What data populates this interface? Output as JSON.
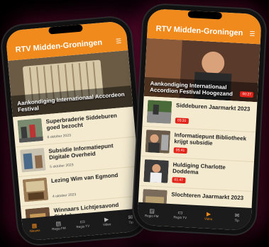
{
  "left_phone": {
    "app_title": "RTV Midden-Groningen",
    "menu_icon": "hamburger-icon",
    "hero_caption": "Aankondiging Internationaal Accordeon Festival",
    "items": [
      {
        "title": "Superbraderie Siddeburen goed bezocht",
        "date": "6 oktober 2023"
      },
      {
        "title": "Subsidie Informatiepunt Digitale Overheid",
        "date": "5 oktober 2023"
      },
      {
        "title": "Lezing Wim van Egmond",
        "date": "4 oktober 2023"
      },
      {
        "title": "Winnaars Lichtjesavond Siddeburen",
        "date": ""
      }
    ],
    "tabs": [
      {
        "label": "Nieuws",
        "icon": "newspaper-icon"
      },
      {
        "label": "Regio FM",
        "icon": "radio-icon"
      },
      {
        "label": "Regio TV",
        "icon": "tv-icon"
      },
      {
        "label": "Video",
        "icon": "video-icon"
      },
      {
        "label": "Tip",
        "icon": "chat-icon"
      }
    ],
    "active_tab": 0
  },
  "right_phone": {
    "app_title": "RTV Midden-Groningen",
    "menu_icon": "hamburger-icon",
    "hero_caption": "Aankondiging Internationaal Accordion Festival Hoogezand",
    "hero_badge": "00:27",
    "items": [
      {
        "title": "Siddeburen Jaarmarkt 2023",
        "badge": "03:31"
      },
      {
        "title": "Informatiepunt Bibliotheek krijgt subsidie",
        "badge": "05:41"
      },
      {
        "title": "Huldiging Charlotte Doddema",
        "badge": "01:47"
      },
      {
        "title": "Slochteren Jaarmarkt 2023",
        "badge": ""
      }
    ],
    "tabs": [
      {
        "label": "Regio FM",
        "icon": "radio-icon"
      },
      {
        "label": "Regio TV",
        "icon": "tv-icon"
      },
      {
        "label": "Video",
        "icon": "video-icon"
      },
      {
        "label": "Tip",
        "icon": "chat-icon"
      }
    ],
    "active_tab": 2
  },
  "colors": {
    "accent": "#f08a1c",
    "badge": "#e2231a",
    "background": "#f4ead0",
    "tabbar": "#1b1b1b"
  }
}
